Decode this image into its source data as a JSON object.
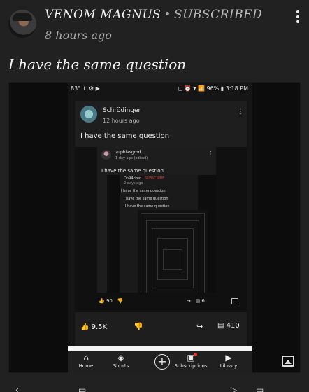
{
  "post": {
    "author": "VENOM MAGNUS",
    "separator": "•",
    "subscribed": "SUBSCRIBED",
    "time": "8 hours ago",
    "text": "I have the same question"
  },
  "screenshot": {
    "status_left": "83° ⬆ ⚙ ▶",
    "status_right": "◻ ⏰ ▾ 📶 96% ▮ 3:18 PM",
    "card": {
      "name": "Schrödinger",
      "time": "12 hours ago",
      "text": "I have the same question",
      "likes": "9.5K",
      "comments": "410"
    },
    "inner": {
      "name": "zuphiasgmd",
      "time": "1 day ago (edited)",
      "text": "I have the same question",
      "likes": "90",
      "comments": "6"
    },
    "deep": {
      "name": "Oh94cken",
      "subscribe": "· SUBSCRIBE",
      "time": "2 days ago",
      "lines": [
        "I have the same question",
        "I have the same question",
        "I have the same question"
      ]
    },
    "nav": [
      {
        "label": "Home",
        "icon": "home-icon"
      },
      {
        "label": "Shorts",
        "icon": "shorts-icon"
      },
      {
        "label": "Subscriptions",
        "icon": "subscriptions-icon"
      },
      {
        "label": "Library",
        "icon": "library-icon"
      }
    ]
  }
}
